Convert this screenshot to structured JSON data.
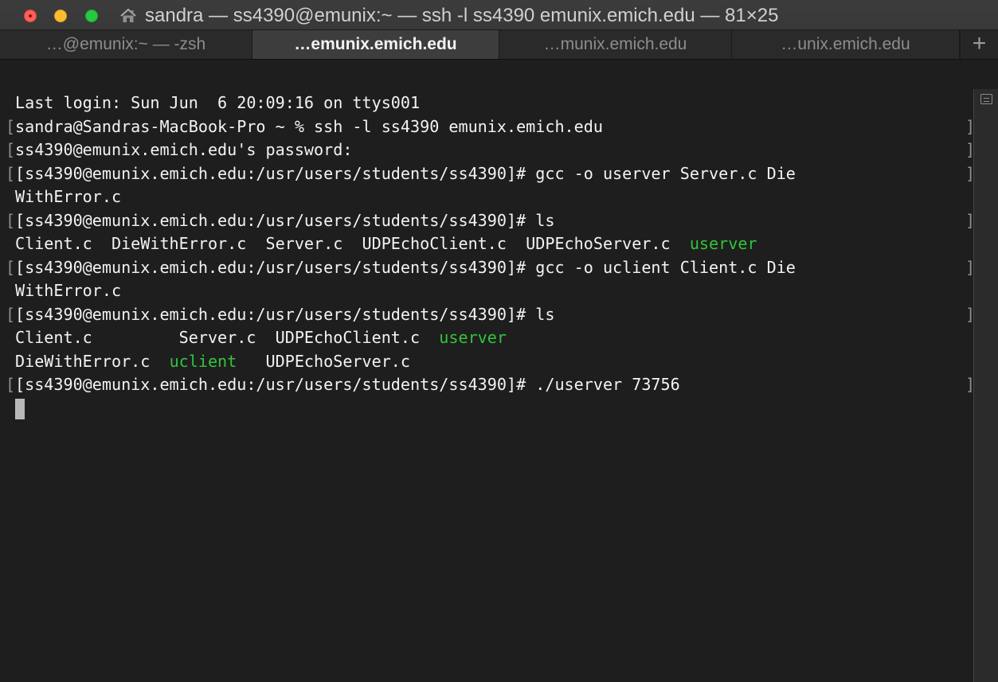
{
  "window": {
    "title": "sandra — ss4390@emunix:~ — ssh -l ss4390 emunix.emich.edu — 81×25",
    "title_icon": "home-icon"
  },
  "tabs": [
    {
      "label": "…@emunix:~ — -zsh"
    },
    {
      "label": "…emunix.emich.edu"
    },
    {
      "label": "…munix.emich.edu"
    },
    {
      "label": "…unix.emich.edu"
    }
  ],
  "new_tab_label": "+",
  "terminal": {
    "lines": [
      {
        "left_mark": "",
        "right_mark": "",
        "parts": [
          {
            "text": "Last login: Sun Jun  6 20:09:16 on ttys001",
            "class": ""
          }
        ]
      },
      {
        "left_mark": "[",
        "right_mark": "]",
        "parts": [
          {
            "text": "sandra@Sandras-MacBook-Pro ~ % ssh -l ss4390 emunix.emich.edu",
            "class": ""
          }
        ]
      },
      {
        "left_mark": "[",
        "right_mark": "]",
        "parts": [
          {
            "text": "ss4390@emunix.emich.edu's password:",
            "class": ""
          }
        ]
      },
      {
        "left_mark": "[",
        "right_mark": "]",
        "parts": [
          {
            "text": "[ss4390@emunix.emich.edu:/usr/users/students/ss4390]# gcc -o userver Server.c Die",
            "class": ""
          }
        ]
      },
      {
        "left_mark": "",
        "right_mark": "",
        "parts": [
          {
            "text": "WithError.c",
            "class": ""
          }
        ]
      },
      {
        "left_mark": "[",
        "right_mark": "]",
        "parts": [
          {
            "text": "[ss4390@emunix.emich.edu:/usr/users/students/ss4390]# ls",
            "class": ""
          }
        ]
      },
      {
        "left_mark": "",
        "right_mark": "",
        "parts": [
          {
            "text": "Client.c  DieWithError.c  Server.c  UDPEchoClient.c  UDPEchoServer.c  ",
            "class": ""
          },
          {
            "text": "userver",
            "class": "green"
          }
        ]
      },
      {
        "left_mark": "[",
        "right_mark": "]",
        "parts": [
          {
            "text": "[ss4390@emunix.emich.edu:/usr/users/students/ss4390]# gcc -o uclient Client.c Die",
            "class": ""
          }
        ]
      },
      {
        "left_mark": "",
        "right_mark": "",
        "parts": [
          {
            "text": "WithError.c",
            "class": ""
          }
        ]
      },
      {
        "left_mark": "[",
        "right_mark": "]",
        "parts": [
          {
            "text": "[ss4390@emunix.emich.edu:/usr/users/students/ss4390]# ls",
            "class": ""
          }
        ]
      },
      {
        "left_mark": "",
        "right_mark": "",
        "parts": [
          {
            "text": "Client.c         Server.c  UDPEchoClient.c  ",
            "class": ""
          },
          {
            "text": "userver",
            "class": "green"
          }
        ]
      },
      {
        "left_mark": "",
        "right_mark": "",
        "parts": [
          {
            "text": "DieWithError.c  ",
            "class": ""
          },
          {
            "text": "uclient",
            "class": "green"
          },
          {
            "text": "   UDPEchoServer.c",
            "class": ""
          }
        ]
      },
      {
        "left_mark": "[",
        "right_mark": "]",
        "parts": [
          {
            "text": "[ss4390@emunix.emich.edu:/usr/users/students/ss4390]# ./userver 73756",
            "class": ""
          }
        ]
      }
    ]
  },
  "scrollbar": {
    "icon": "scrollbar-toggle-icon"
  },
  "colors": {
    "background": "#1e1e1e",
    "text": "#f3f3f3",
    "executable": "#31c43b",
    "close_button": "#ff5f57",
    "minimize_button": "#febc2e",
    "zoom_button": "#28c840"
  }
}
